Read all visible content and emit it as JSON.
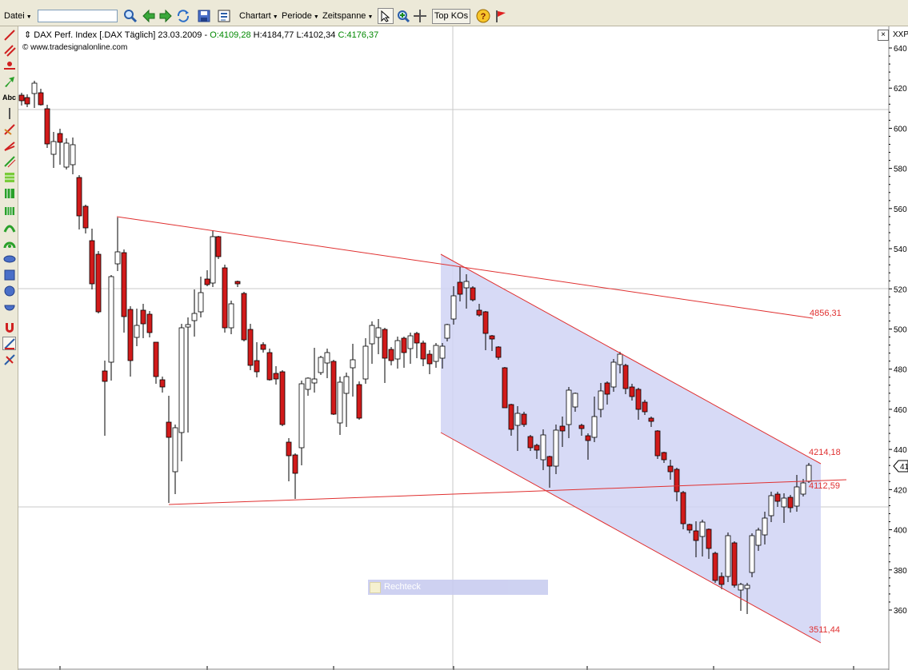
{
  "toolbar": {
    "file_menu": "Datei",
    "search_value": "",
    "chart_type_menu": "Chartart",
    "period_menu": "Periode",
    "timespan_menu": "Zeitspanne",
    "top_kos_button": "Top KOs"
  },
  "chart": {
    "header": {
      "instrument": "DAX Perf. Index [.DAX  Täglich] 23.03.2009 - ",
      "open": "O:4109,28",
      "high": "H:4184,77",
      "low": "L:4102,34",
      "close": "C:4176,37"
    },
    "copyright": "© www.tradesignalonline.com",
    "close_button": "×",
    "axis_header": "XXP",
    "last_price_tag": "41",
    "drawing_label": "Rechteck",
    "y_axis_labels": [
      "640",
      "620",
      "600",
      "580",
      "560",
      "540",
      "520",
      "500",
      "480",
      "460",
      "440",
      "420",
      "400",
      "380",
      "360"
    ],
    "line_labels": {
      "upper_trendline": "4856,31",
      "channel_top": "4214,18",
      "support": "4112,59",
      "channel_bottom": "3511,44"
    },
    "colors": {
      "up_candle": "#ffffff",
      "down_candle": "#d11a1a",
      "trendline": "#e03030",
      "channel_fill": "#d0d4f4"
    }
  }
}
